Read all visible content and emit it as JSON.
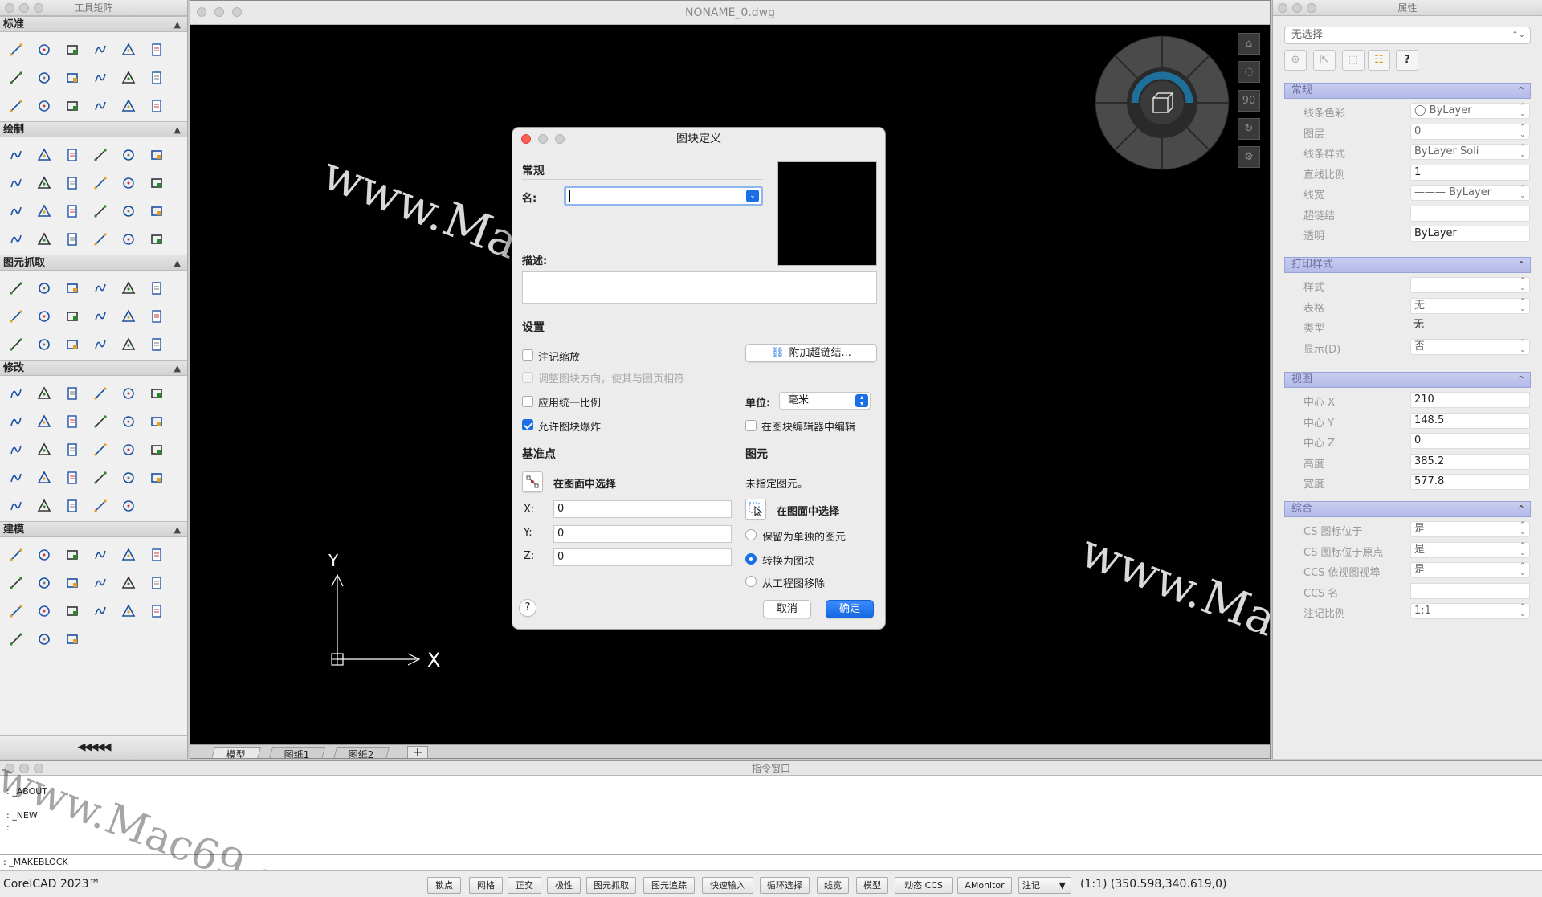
{
  "toolbox": {
    "title": "工具矩阵",
    "sections": [
      {
        "label": "标准",
        "icons": [
          "new-icon",
          "open-icon",
          "save-icon",
          "print-icon",
          "plot-icon",
          "preview-icon",
          "publish-icon",
          "cut-icon",
          "copy-icon",
          "paste-icon",
          "match-props-icon",
          "undo-icon",
          "redo-icon",
          "pan-icon",
          "zoom-icon",
          "zoom-realtime-icon",
          "layers-icon",
          "design-center-icon"
        ]
      },
      {
        "label": "绘制",
        "icons": [
          "line-icon",
          "polyline-icon",
          "circle-icon",
          "rectangle-icon",
          "arc-icon",
          "spline-icon",
          "donut-icon",
          "ellipse-icon",
          "revcloud-icon",
          "point-icon",
          "curve-icon",
          "infinite-line-icon",
          "ray-icon",
          "multiline-icon",
          "hatch-icon",
          "block-icon",
          "region-icon",
          "text-icon",
          "attribute-icon",
          "table-icon",
          "rectangle-select-icon",
          "cloud-icon",
          "gear-shape-icon",
          "group-icon"
        ]
      },
      {
        "label": "图元抓取",
        "icons": [
          "snap-endpoint-icon",
          "snap-midpoint-icon",
          "snap-intersection-icon",
          "snap-apparent-icon",
          "snap-extension-icon",
          "snap-perpendicular-icon",
          "snap-nearest-icon",
          "snap-center-icon",
          "snap-node-icon",
          "snap-quadrant-icon",
          "snap-tangent-icon",
          "snap-insertion-icon",
          "snap-track-icon",
          "snap-parallel-icon",
          "snap-clear-icon",
          "snap-none-icon",
          "snap-settings-icon",
          "snap-toggle-icon"
        ]
      },
      {
        "label": "修改",
        "icons": [
          "erase-icon",
          "erase-select-icon",
          "move-icon",
          "copy-obj-icon",
          "mirror-icon",
          "scale-icon",
          "offset-icon",
          "array-icon",
          "rotate-icon",
          "stretch-icon",
          "align-icon",
          "break-icon",
          "fillet-icon",
          "chamfer-icon",
          "trim-corner-icon",
          "trim-extend-icon",
          "edit-boundary-icon",
          "join-icon",
          "text-edit-icon",
          "trim-icon",
          "extend-icon",
          "lengthen-icon",
          "explode-icon",
          "draw-order-icon",
          "properties-icon",
          "attach-icon",
          "pedit-icon",
          "wblock-icon",
          "grid-toggle-icon"
        ]
      },
      {
        "label": "建模",
        "icons": [
          "box-icon",
          "cone-icon",
          "cylinder-icon",
          "pyramid-icon",
          "sphere-icon",
          "torus-icon",
          "wedge-icon",
          "planar-surface-icon",
          "extrude-icon",
          "revolve-icon",
          "sweep-icon",
          "loft-icon",
          "presspull-icon",
          "helix-icon",
          "union-icon",
          "subtract-icon",
          "intersect-icon",
          "slice-icon",
          "polysolid-icon",
          "section-icon",
          "render-icon"
        ]
      }
    ],
    "collapse_label": "◀◀◀◀◀"
  },
  "drawing": {
    "title": "NONAME_0.dwg",
    "tabs": [
      "模型",
      "图纸1",
      "图纸2"
    ],
    "add_tab": "+",
    "axis_x": "X",
    "axis_y": "Y",
    "watermark": "www.Mac69.com",
    "nav_angle": "90"
  },
  "dialog": {
    "title": "图块定义",
    "general_heading": "常规",
    "name_label": "名:",
    "name_value": "",
    "desc_label": "描述:",
    "desc_value": "",
    "settings_heading": "设置",
    "annotative_label": "注记缩放",
    "annotative_checked": false,
    "orient_label": "调整图块方向，使其与图页相符",
    "hyperlink_button": "附加超链结...",
    "uniform_scale_label": "应用统一比例",
    "units_label": "单位:",
    "units_value": "毫米",
    "allow_explode_label": "允许图块爆炸",
    "allow_explode_checked": true,
    "edit_in_editor_label": "在图块编辑器中编辑",
    "basepoint_heading": "基准点",
    "pick_in_drawing_label": "在图面中选择",
    "x_label": "X:",
    "x_value": "0",
    "y_label": "Y:",
    "y_value": "0",
    "z_label": "Z:",
    "z_value": "0",
    "entities_heading": "图元",
    "no_entities_label": "未指定图元。",
    "select_in_drawing_label": "在图面中选择",
    "retain_label": "保留为单独的图元",
    "convert_label": "转换为图块",
    "delete_label": "从工程图移除",
    "selected_option": "转换为图块",
    "help_label": "?",
    "cancel_label": "取消",
    "ok_label": "确定"
  },
  "properties": {
    "title": "属性",
    "selection": "无选择",
    "help_label": "?",
    "groups": [
      {
        "heading": "常规",
        "rows": [
          {
            "key": "线条色彩",
            "value": "◯ ByLayer",
            "dd": true
          },
          {
            "key": "图层",
            "value": "0",
            "dd": true
          },
          {
            "key": "线条样式",
            "value": "ByLayer     Soli",
            "dd": true
          },
          {
            "key": "直线比例",
            "value": "1",
            "dd": false
          },
          {
            "key": "线宽",
            "value": "——— ByLayer",
            "dd": true
          },
          {
            "key": "超链结",
            "value": "",
            "dd": false
          },
          {
            "key": "透明",
            "value": "ByLayer",
            "dd": false
          }
        ]
      },
      {
        "heading": "打印样式",
        "rows": [
          {
            "key": "样式",
            "value": "",
            "dd": true
          },
          {
            "key": "表格",
            "value": "无",
            "dd": true
          },
          {
            "key": "类型",
            "value": "无",
            "dd": false,
            "plain": true
          },
          {
            "key": "显示(D)",
            "value": "否",
            "dd": true
          }
        ]
      },
      {
        "heading": "视图",
        "rows": [
          {
            "key": "中心 X",
            "value": "210",
            "dd": false
          },
          {
            "key": "中心 Y",
            "value": "148.5",
            "dd": false
          },
          {
            "key": "中心 Z",
            "value": "0",
            "dd": false
          },
          {
            "key": "高度",
            "value": "385.2",
            "dd": false
          },
          {
            "key": "宽度",
            "value": "577.8",
            "dd": false
          }
        ]
      },
      {
        "heading": "综合",
        "rows": [
          {
            "key": "CS 图标位于",
            "value": "是",
            "dd": true
          },
          {
            "key": "CS 图标位于原点",
            "value": "是",
            "dd": true
          },
          {
            "key": "CCS 依视图视埠",
            "value": "是",
            "dd": true
          },
          {
            "key": "CCS 名",
            "value": "",
            "dd": false
          },
          {
            "key": "注记比例",
            "value": "1:1",
            "dd": true
          }
        ]
      }
    ]
  },
  "command": {
    "title": "指令窗口",
    "history": [
      ": _ABOUT",
      ": _NEW",
      ":"
    ],
    "current": ": _MAKEBLOCK"
  },
  "statusbar": {
    "app": "CorelCAD 2023™",
    "buttons": [
      "锁点",
      "网格",
      "正交",
      "极性",
      "图元抓取",
      "图元追踪",
      "快速输入",
      "循环选择",
      "线宽",
      "模型",
      "动态 CCS",
      "AMonitor"
    ],
    "annotation_label": "注记",
    "scale": "(1:1)",
    "coords": "(350.598,340.619,0)"
  }
}
